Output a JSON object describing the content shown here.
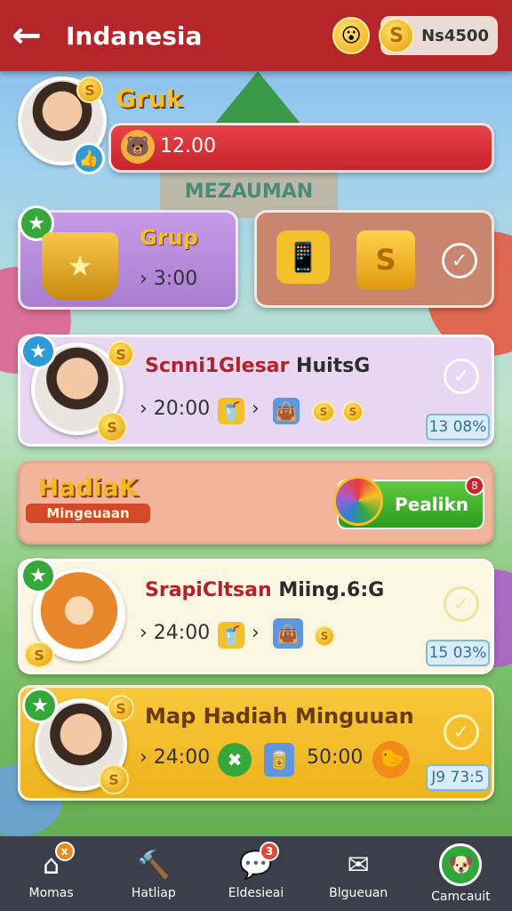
{
  "header": {
    "title": "Indanesia",
    "back_icon": "arrow-left-icon",
    "coins": "Ns4500"
  },
  "profile": {
    "name": "Gruk",
    "points": "12.00"
  },
  "grup_card": {
    "label": "Grup",
    "time": "3:00"
  },
  "rows": [
    {
      "title_red": "Scnni1Glesar",
      "title_dark": "HuitsG",
      "time": "20:00",
      "percent": "13 08%"
    },
    {
      "title_red": "SrapiCltsan",
      "title_dark": "Miing.6:G",
      "time": "24:00",
      "percent": "15 03%"
    },
    {
      "title_red": "",
      "title_dark": "Map Hadiah Minguuan",
      "time": "24:00",
      "time2": "50:00",
      "percent": "J9 73:5"
    }
  ],
  "banner": {
    "logo_line1": "HadiaK",
    "logo_line2": "Mingeuaan",
    "button_label": "Pealikn",
    "button_badge": "8"
  },
  "nav": [
    {
      "label": "Momas",
      "icon": "home-icon",
      "badge": "x"
    },
    {
      "label": "Hatliap",
      "icon": "hammer-icon",
      "badge": ""
    },
    {
      "label": "Eldesieai",
      "icon": "chat-icon",
      "badge": "3"
    },
    {
      "label": "Blgueuan",
      "icon": "envelope-icon",
      "badge": ""
    },
    {
      "label": "Camcauit",
      "icon": "dog-icon",
      "badge": ""
    }
  ],
  "colors": {
    "header_red": "#b5262a",
    "nav_bg": "#3b3f49"
  }
}
